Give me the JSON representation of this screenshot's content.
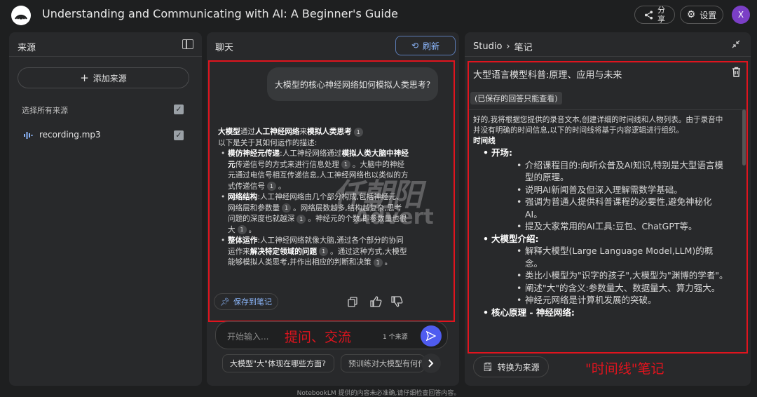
{
  "app": {
    "title": "Understanding and Communicating with AI: A Beginner's Guide",
    "share_label": "分享",
    "settings_label": "设置",
    "avatar_initial": "X"
  },
  "sources": {
    "title": "来源",
    "add_label": "添加来源",
    "select_all_label": "选择所有来源",
    "items": [
      {
        "name": "recording.mp3",
        "checked": true
      }
    ]
  },
  "chat": {
    "title": "聊天",
    "refresh_label": "刷新",
    "user_question": "大模型的核心神经网络如何模拟人类思考?",
    "answer": {
      "intro_a": "大模型",
      "intro_b": "通过",
      "intro_c": "人工神经网络",
      "intro_d": "来",
      "intro_e": "模拟人类思考",
      "intro_line2": "以下是关于其如何运作的描述:",
      "b1_head": "模仿神经元传递",
      "b1_text_a": ":人工神经网络通过",
      "b1_bold": "模拟人类大脑中神经元",
      "b1_text_b": "传递信号的方式来进行信息处理",
      "b1_text_c": "。大脑中的神经元通过电信号相互传递信息,人工神经网络也以类似的方式传递信号",
      "b2_head": "网络结构",
      "b2_text": ":人工神经网络由几个部分构成,包括神经元、网络层和参数量",
      "b2_text_b": "。网络层数越多,结构越复杂,思考问题的深度也就越深",
      "b2_text_c": "。神经元的个数,即参数量也很大",
      "b3_head": "整体运作",
      "b3_text": ":人工神经网络就像大脑,通过各个部分的协同运作来",
      "b3_bold": "解决特定领域的问题",
      "b3_text_b": "。通过这种方式,大模型能够模拟人类思考,并作出相应的判断和决策",
      "cite": "1"
    },
    "watermark_main": "仟朝阳",
    "watermark_sub": "Advert",
    "save_to_note_label": "保存到笔记",
    "input_placeholder": "开始输入...",
    "input_annotation": "提问、交流",
    "source_count": "1 个来源",
    "suggestions": [
      "大模型\"大\"体现在哪些方面?",
      "预训练对大模型有何作"
    ]
  },
  "studio": {
    "crumb_parent": "Studio",
    "crumb_current": "笔记",
    "note_title": "大型语言模型科普:原理、应用与未来",
    "readonly_chip": "(已保存的回答只能查看)",
    "intro": "好的,我将根据您提供的录音文本,创建详细的时间线和人物列表。由于录音中并没有明确的时间信息,以下的时间线将基于内容逻辑进行组织。",
    "timeline_heading": "时间线",
    "sections": [
      {
        "title": "开场:",
        "items": [
          "介绍课程目的:向听众普及AI知识,特别是大型语言模型的原理。",
          "说明AI新闻普及但深入理解需数学基础。",
          "强调为普通人提供科普课程的必要性,避免神秘化AI。",
          "提及大家常用的AI工具:豆包、ChatGPT等。"
        ]
      },
      {
        "title": "大模型介绍:",
        "items": [
          "解释大模型(Large Language Model,LLM)的概念。",
          "类比小模型为\"识字的孩子\",大模型为\"渊博的学者\"。",
          "阐述\"大\"的含义:参数量大、数据量大、算力强大。",
          "神经元网络是计算机发展的突破。"
        ]
      },
      {
        "title": "核心原理 - 神经网络:",
        "items": []
      }
    ],
    "convert_label": "转换为来源",
    "annotation": "\"时间线\"笔记"
  },
  "footer": {
    "disclaimer": "NotebookLM 提供的内容未必准确,请仔细检查回答内容。"
  },
  "colors": {
    "accent": "#8ab4f8",
    "send": "#4f5cf0",
    "annotation_red": "#e0141e",
    "avatar": "#7b3fc6"
  }
}
